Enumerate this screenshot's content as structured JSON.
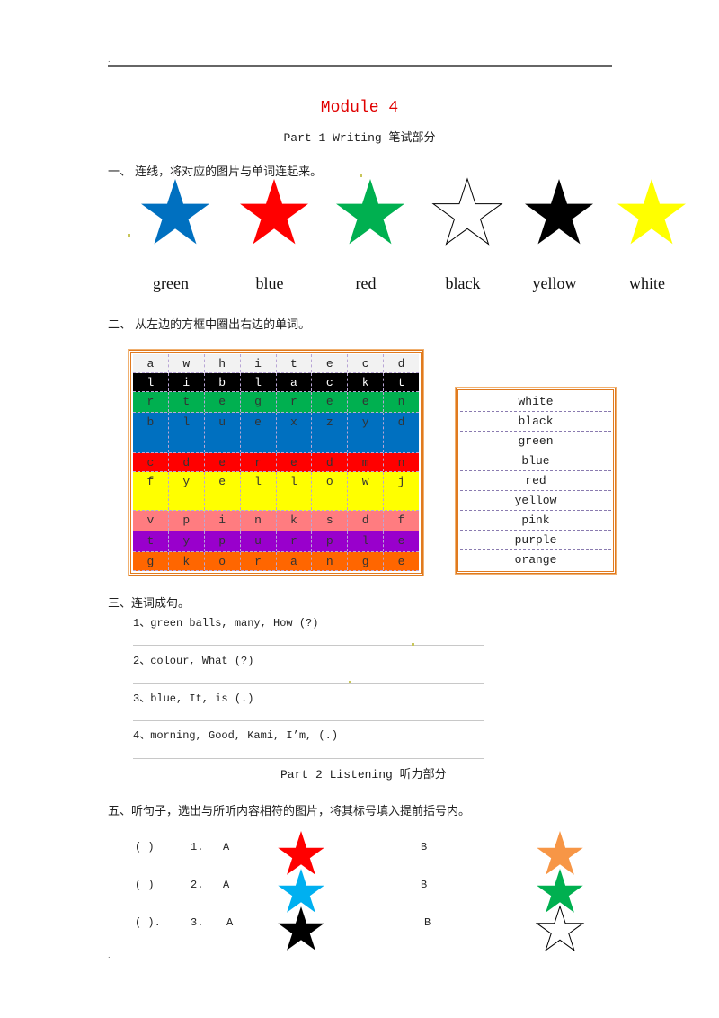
{
  "header": {
    "dot": "."
  },
  "title": "Module 4",
  "subtitle": "Part 1 Writing 笔试部分",
  "section1": {
    "heading": "一、 连线，将对应的图片与单词连起来。",
    "stars": [
      {
        "name": "blue-star",
        "fill": "#0070c0"
      },
      {
        "name": "red-star",
        "fill": "#ff0000"
      },
      {
        "name": "green-star",
        "fill": "#00b050"
      },
      {
        "name": "white-star",
        "fill": "#ffffff"
      },
      {
        "name": "black-star",
        "fill": "#000000"
      },
      {
        "name": "yellow-star",
        "fill": "#ffff00"
      }
    ],
    "words": [
      "green",
      "blue",
      "red",
      "black",
      "yellow",
      "white"
    ]
  },
  "section2": {
    "heading": "二、 从左边的方框中圈出右边的单词。",
    "grid": [
      {
        "bg": "#f2f2f2",
        "color": "#222",
        "letters": [
          "a",
          "w",
          "h",
          "i",
          "t",
          "e",
          "c",
          "d"
        ]
      },
      {
        "bg": "#000000",
        "color": "#ffffff",
        "letters": [
          "l",
          "i",
          "b",
          "l",
          "a",
          "c",
          "k",
          "t"
        ]
      },
      {
        "bg": "#00b050",
        "color": "#333",
        "letters": [
          "r",
          "t",
          "e",
          "g",
          "r",
          "e",
          "e",
          "n"
        ]
      },
      {
        "bg": "#0070c0",
        "color": "#333",
        "letters": [
          "b",
          "l",
          "u",
          "e",
          "x",
          "z",
          "y",
          "d"
        ]
      },
      {
        "bg": "#ff0000",
        "color": "#333",
        "letters": [
          "c",
          "d",
          "e",
          "r",
          "e",
          "d",
          "m",
          "n"
        ]
      },
      {
        "bg": "#ffff00",
        "color": "#333",
        "letters": [
          "f",
          "y",
          "e",
          "l",
          "l",
          "o",
          "w",
          "j"
        ]
      },
      {
        "bg": "#ff7c80",
        "color": "#333",
        "letters": [
          "v",
          "p",
          "i",
          "n",
          "k",
          "s",
          "d",
          "f"
        ]
      },
      {
        "bg": "#9900cc",
        "color": "#333",
        "letters": [
          "t",
          "y",
          "p",
          "u",
          "r",
          "p",
          "l",
          "e"
        ]
      },
      {
        "bg": "#ff6600",
        "color": "#333",
        "letters": [
          "g",
          "k",
          "o",
          "r",
          "a",
          "n",
          "g",
          "e"
        ]
      }
    ],
    "word_list": [
      "white",
      "black",
      "green",
      "blue",
      "red",
      "yellow",
      "pink",
      "purple",
      "orange"
    ]
  },
  "section3": {
    "heading": "三、连词成句。",
    "items": [
      "1、green balls, many, How (?)",
      "2、colour, What (?)",
      "3、blue, It, is (.)",
      "4、morning, Good, Kami, I’m, (.)"
    ]
  },
  "part2": "Part 2 Listening 听力部分",
  "section5": {
    "heading": "五、听句子，选出与所听内容相符的图片，将其标号填入提前括号内。",
    "rows": [
      {
        "bracket": "(      )",
        "num": "1.",
        "a_label": "A",
        "b_label": "B",
        "a_fill": "#ff0000",
        "b_fill": "#f79646"
      },
      {
        "bracket": "(      )",
        "num": "2.",
        "a_label": "A",
        "b_label": "B",
        "a_fill": "#00b0f0",
        "b_fill": "#00b050"
      },
      {
        "bracket": "(      ).",
        "num": "3.",
        "a_label": "A",
        "b_label": "B",
        "a_fill": "#000000",
        "b_fill": "#ffffff"
      }
    ]
  },
  "footer": {
    "dot": "."
  }
}
